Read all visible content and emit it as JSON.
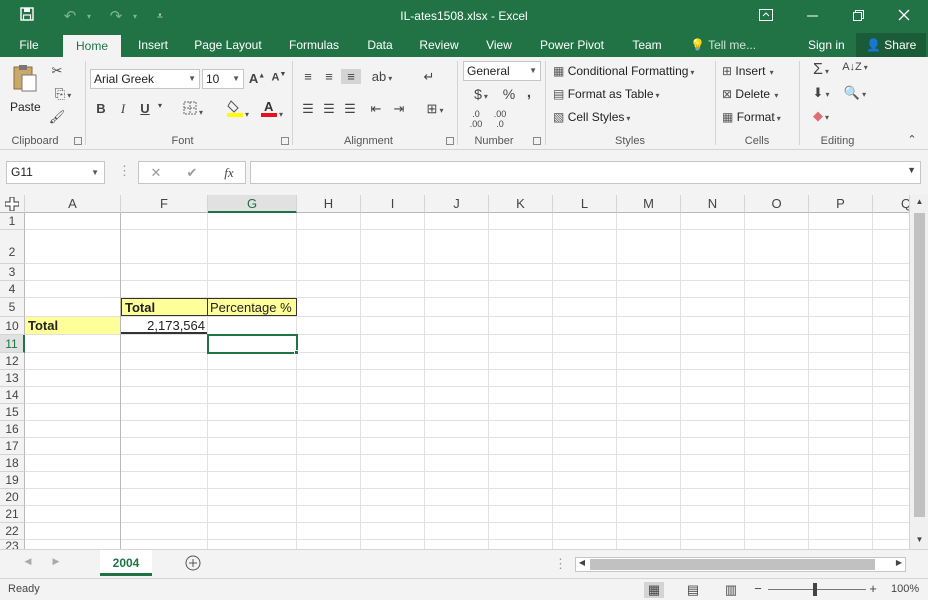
{
  "window": {
    "title": "IL-ates1508.xlsx - Excel"
  },
  "titlebar": {
    "icons": [
      "save-icon",
      "undo-icon",
      "redo-icon",
      "customize-qat-icon",
      "ribbon-display-icon",
      "minimize-icon",
      "restore-icon",
      "close-icon"
    ]
  },
  "tabs": {
    "file": "File",
    "home": "Home",
    "insert": "Insert",
    "page_layout": "Page Layout",
    "formulas": "Formulas",
    "data": "Data",
    "review": "Review",
    "view": "View",
    "power_pivot": "Power Pivot",
    "team": "Team",
    "tell_me": "Tell me...",
    "sign_in": "Sign in",
    "share": "Share"
  },
  "ribbon": {
    "clipboard": {
      "paste": "Paste",
      "label": "Clipboard"
    },
    "font": {
      "name": "Arial Greek",
      "size": "10",
      "label": "Font",
      "bold": "B",
      "italic": "I",
      "underline": "U"
    },
    "alignment": {
      "label": "Alignment"
    },
    "number": {
      "format": "General",
      "currency": "$",
      "percent": "%",
      "comma": ",",
      "label": "Number"
    },
    "styles": {
      "conditional": "Conditional Formatting",
      "format_table": "Format as Table",
      "cell_styles": "Cell Styles",
      "label": "Styles"
    },
    "cells": {
      "insert": "Insert",
      "delete": "Delete",
      "format": "Format",
      "label": "Cells"
    },
    "editing": {
      "label": "Editing"
    }
  },
  "formula_bar": {
    "name_box": "G11",
    "cancel": "✕",
    "enter": "✔",
    "fx": "fx",
    "value": ""
  },
  "grid": {
    "columns": [
      "A",
      "F",
      "G",
      "H",
      "I",
      "J",
      "K",
      "L",
      "M",
      "N",
      "O",
      "P",
      "Q"
    ],
    "rows": [
      "1",
      "2",
      "3",
      "4",
      "5",
      "10",
      "11",
      "12",
      "13",
      "14",
      "15",
      "16",
      "17",
      "18",
      "19",
      "20",
      "21",
      "22",
      "23"
    ],
    "selected_cell": "G11",
    "cells": {
      "F5": "Total",
      "G5": "Percentage %",
      "A10": "Total",
      "F10": "2,173,564"
    },
    "fill_color": "#ffff99",
    "accent": "#217346"
  },
  "sheets": {
    "active": "2004"
  },
  "status": {
    "mode": "Ready",
    "zoom": "100%"
  }
}
